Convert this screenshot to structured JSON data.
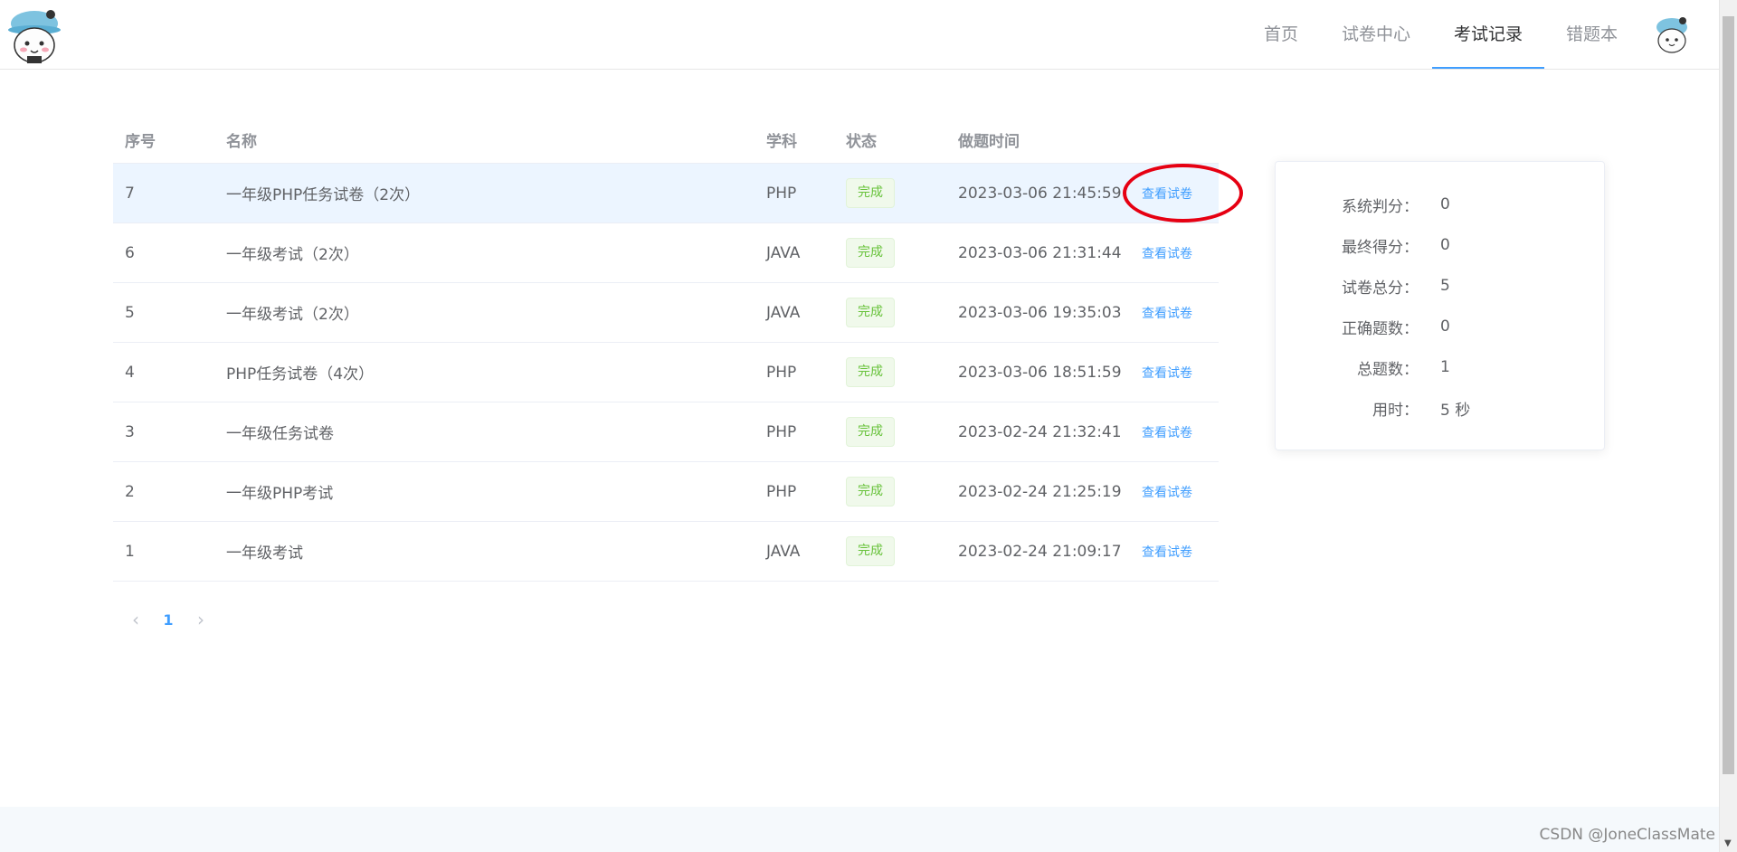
{
  "header": {
    "nav": [
      {
        "label": "首页",
        "active": false
      },
      {
        "label": "试卷中心",
        "active": false
      },
      {
        "label": "考试记录",
        "active": true
      },
      {
        "label": "错题本",
        "active": false
      }
    ]
  },
  "table": {
    "columns": [
      "序号",
      "名称",
      "学科",
      "状态",
      "做题时间"
    ],
    "rows": [
      {
        "no": "7",
        "name": "一年级PHP任务试卷（2次）",
        "subject": "PHP",
        "status": "完成",
        "time": "2023-03-06 21:45:59",
        "action": "查看试卷"
      },
      {
        "no": "6",
        "name": "一年级考试（2次）",
        "subject": "JAVA",
        "status": "完成",
        "time": "2023-03-06 21:31:44",
        "action": "查看试卷"
      },
      {
        "no": "5",
        "name": "一年级考试（2次）",
        "subject": "JAVA",
        "status": "完成",
        "time": "2023-03-06 19:35:03",
        "action": "查看试卷"
      },
      {
        "no": "4",
        "name": "PHP任务试卷（4次）",
        "subject": "PHP",
        "status": "完成",
        "time": "2023-03-06 18:51:59",
        "action": "查看试卷"
      },
      {
        "no": "3",
        "name": "一年级任务试卷",
        "subject": "PHP",
        "status": "完成",
        "time": "2023-02-24 21:32:41",
        "action": "查看试卷"
      },
      {
        "no": "2",
        "name": "一年级PHP考试",
        "subject": "PHP",
        "status": "完成",
        "time": "2023-02-24 21:25:19",
        "action": "查看试卷"
      },
      {
        "no": "1",
        "name": "一年级考试",
        "subject": "JAVA",
        "status": "完成",
        "time": "2023-02-24 21:09:17",
        "action": "查看试卷"
      }
    ]
  },
  "pagination": {
    "current": "1",
    "prev_icon": "chevron-left-icon",
    "next_icon": "chevron-right-icon"
  },
  "summary": [
    {
      "label": "系统判分：",
      "value": "0"
    },
    {
      "label": "最终得分：",
      "value": "0"
    },
    {
      "label": "试卷总分：",
      "value": "5"
    },
    {
      "label": "正确题数：",
      "value": "0"
    },
    {
      "label": "总题数：",
      "value": "1"
    },
    {
      "label": "用时：",
      "value": "5 秒"
    }
  ],
  "watermark": "CSDN @JoneClassMate",
  "colors": {
    "accent": "#409eff",
    "success": "#67c23a",
    "annotation": "#e60012",
    "row_highlight": "#ecf5ff"
  }
}
